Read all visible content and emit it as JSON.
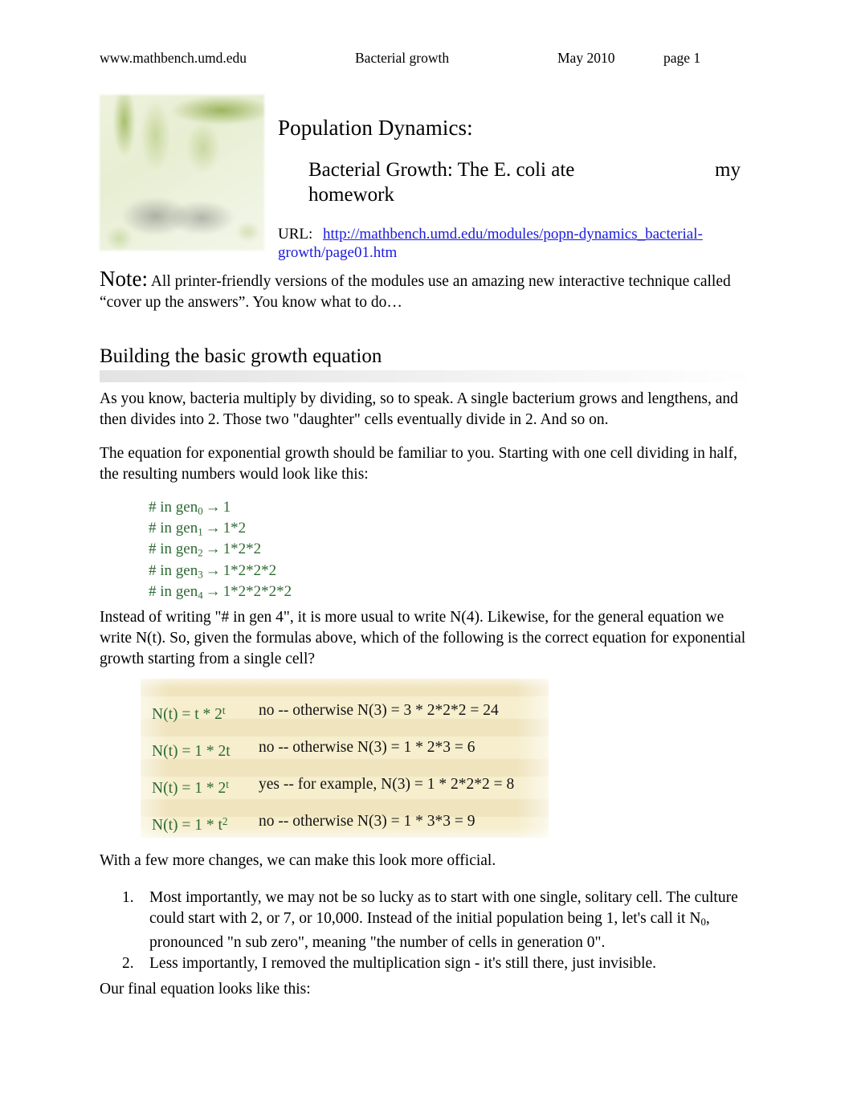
{
  "header": {
    "site_url": "www.mathbench.umd.edu",
    "doc_title": "Bacterial growth",
    "date": "May 2010",
    "page_number": "page 1"
  },
  "masthead": {
    "logo_alt": "MathBench logo",
    "title_main": "Population Dynamics:",
    "title_sub_lead": "Bacterial Growth: The E. coli ate",
    "title_sub_tail": "my",
    "title_sub_line2": "homework",
    "url_label": "URL:",
    "url_line1": "http://mathbench.umd.edu/modules/popn-dynamics_bacterial-",
    "url_line2": "growth/page01.htm",
    "url_color": "#1a1ae0"
  },
  "note": {
    "label": "Note:",
    "text": "All printer-friendly versions of the modules use an amazing new interactive technique called “cover up the answers”.  You know what to do…"
  },
  "section": {
    "heading": "Building the basic growth equation"
  },
  "paragraphs": {
    "p1": "As you know, bacteria multiply by dividing, so to speak. A single bacterium grows and lengthens, and then divides into 2. Those two \"daughter\" cells eventually divide in 2. And so on.",
    "p2": "The equation for exponential growth should be familiar to you. Starting with one cell dividing in half, the resulting numbers would look like this:",
    "p3": "Instead of writing \"# in gen 4\", it is more usual to write N(4). Likewise, for the general equation we write N(t). So, given the formulas above, which of the following is the correct equation for exponential growth starting from a single cell?",
    "p4": "With a few more changes, we can make this look more official.",
    "p5": "Our final equation looks like this:"
  },
  "generations": {
    "color": "#2d6a33",
    "rows": [
      {
        "label": "# in gen",
        "sub": "0",
        "arrow": "→",
        "value": "1"
      },
      {
        "label": "# in gen",
        "sub": "1",
        "arrow": "→",
        "value": "1*2"
      },
      {
        "label": "# in gen",
        "sub": "2",
        "arrow": "→",
        "value": "1*2*2"
      },
      {
        "label": "# in gen",
        "sub": "3",
        "arrow": "→",
        "value": "1*2*2*2"
      },
      {
        "label": "# in gen",
        "sub": "4",
        "arrow": "→",
        "value": "1*2*2*2*2"
      }
    ]
  },
  "answer_box": {
    "background_color": "#f2e7c3",
    "formula_color": "#2d6a33",
    "rows": [
      {
        "formula_lead": "N(t) = t * 2",
        "formula_sup": "t",
        "formula_trail": "",
        "verdict": "no -- otherwise N(3) = 3 * 2*2*2 = 24"
      },
      {
        "formula_lead": "N(t) = 1 * 2t",
        "formula_sup": "",
        "formula_trail": "",
        "verdict": "no -- otherwise N(3) = 1 * 2*3 = 6"
      },
      {
        "formula_lead": "N(t) = 1 * 2",
        "formula_sup": "t",
        "formula_trail": "",
        "verdict": "yes -- for example, N(3) = 1 * 2*2*2 = 8"
      },
      {
        "formula_lead": "N(t) = 1 * t",
        "formula_sup": "2",
        "formula_trail": "",
        "verdict": "no -- otherwise N(3) = 1 * 3*3 = 9"
      }
    ]
  },
  "numbered_list": {
    "items": [
      {
        "marker": "1.",
        "text_before_sub": "Most importantly, we may not be so lucky as to start with one single, solitary cell. The culture could start with 2, or 7, or 10,000. Instead of the initial population being 1, let's call it N",
        "sub": "0",
        "text_after_sub": ", pronounced \"n sub zero\", meaning \"the number of cells in generation 0\"."
      },
      {
        "marker": "2.",
        "text_before_sub": "Less importantly, I removed the multiplication sign - it's still there, just invisible.",
        "sub": "",
        "text_after_sub": ""
      }
    ]
  }
}
